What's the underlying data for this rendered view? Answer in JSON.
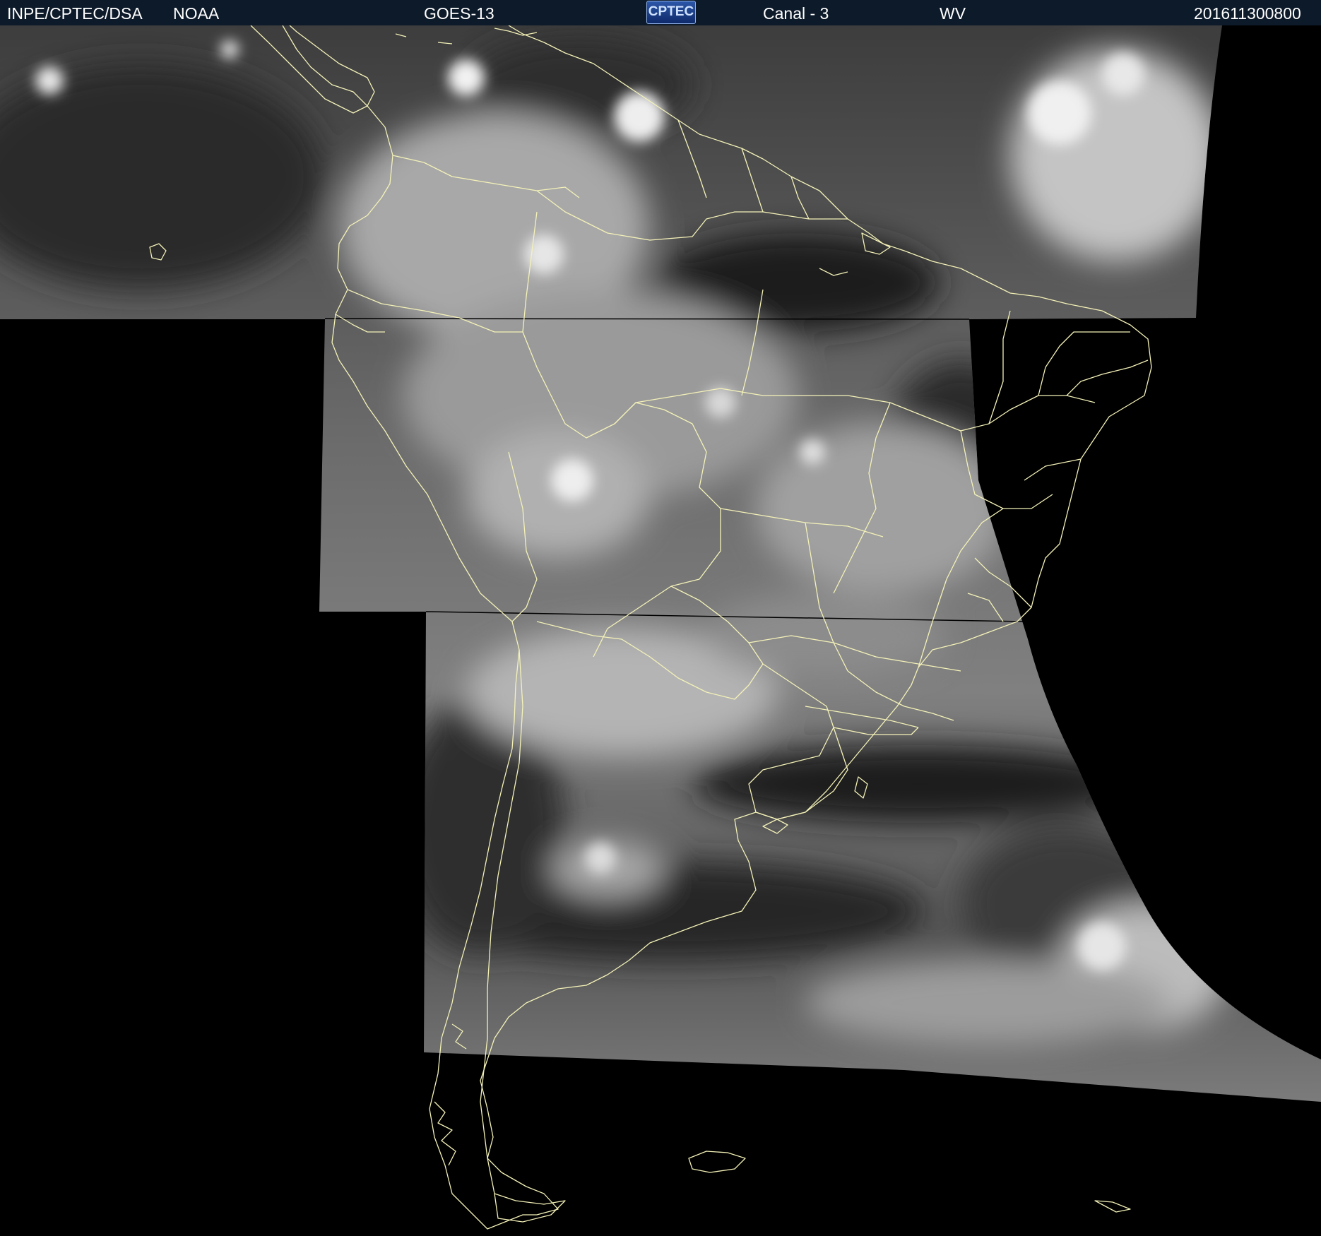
{
  "header": {
    "source": "INPE/CPTEC/DSA",
    "agency": "NOAA",
    "satellite": "GOES-13",
    "logo_text": "CPTEC",
    "channel": "Canal - 3",
    "band": "WV",
    "timestamp": "201611300800"
  },
  "colors": {
    "header_background": "#0d1a2a",
    "header_text": "#ffffff",
    "boundary_lines": "#f4f2b8",
    "space_background": "#000000"
  },
  "map": {
    "region": "South America",
    "imagery": "water vapor, grayscale",
    "overlay": "country and state boundaries"
  }
}
